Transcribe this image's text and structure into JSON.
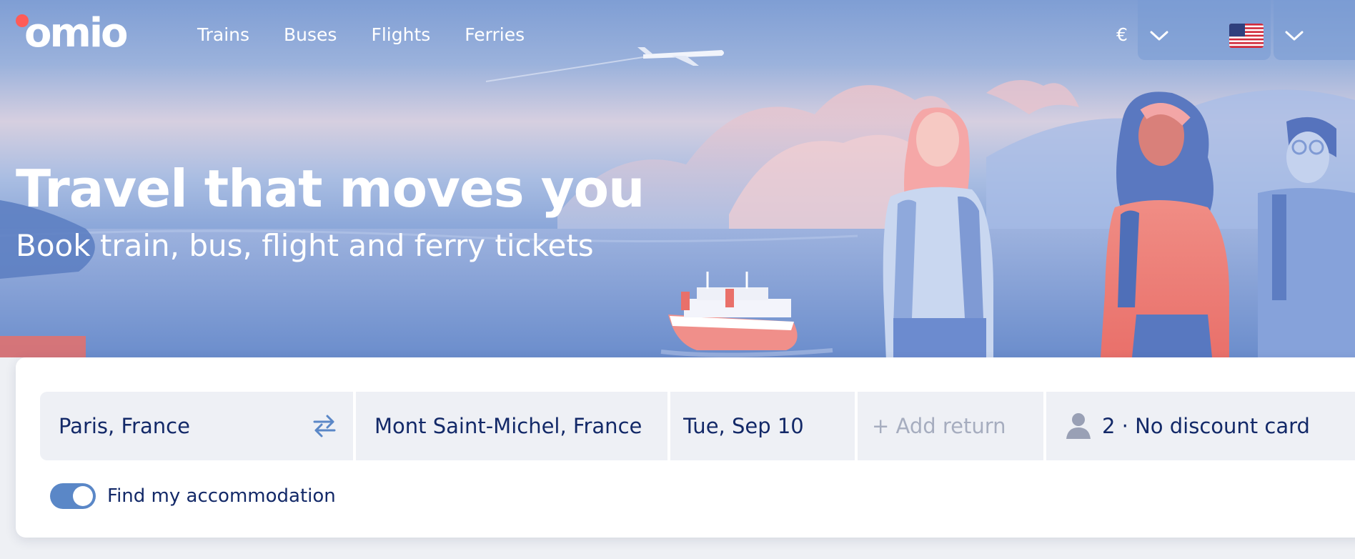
{
  "brand": {
    "logo_text": "omio",
    "accent_color": "#ff5b57"
  },
  "nav": {
    "items": [
      {
        "label": "Trains"
      },
      {
        "label": "Buses"
      },
      {
        "label": "Flights"
      },
      {
        "label": "Ferries"
      }
    ]
  },
  "header": {
    "currency_symbol": "€",
    "currency_icon": "chevron-down-icon",
    "language_flag": "us-flag-icon"
  },
  "hero": {
    "title": "Travel that moves you",
    "subtitle": "Book train, bus, flight and ferry tickets"
  },
  "search": {
    "from": "Paris, France",
    "to": "Mont Saint-Michel, France",
    "date": "Tue, Sep 10",
    "return_placeholder": "+ Add return",
    "passengers": "2 · No discount card",
    "swap_icon": "swap-arrows-icon",
    "passenger_icon": "person-icon"
  },
  "options": {
    "accommodation_label": "Find my accommodation",
    "accommodation_enabled": true
  },
  "colors": {
    "primary_text": "#132968",
    "field_background": "#eef0f5",
    "toggle_on": "#5a87c7"
  }
}
